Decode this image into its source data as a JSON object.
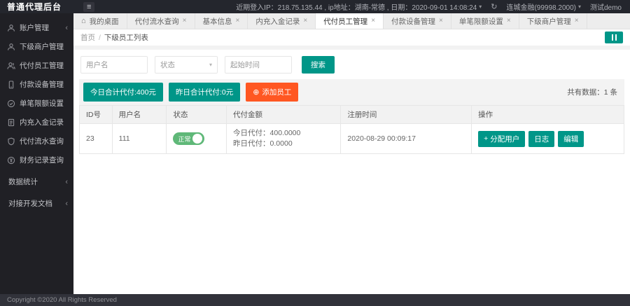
{
  "colors": {
    "teal": "#009688",
    "orange": "#FF5722",
    "green": "#5FB878",
    "header_bg": "#24262D",
    "sidebar_bg": "#202025",
    "footer_bg": "#31323A"
  },
  "icons": {
    "hamburger": "≡",
    "home": "⌂",
    "close": "×",
    "chevron_left": "‹",
    "caret_down": "▾",
    "refresh": "↻",
    "plus": "+"
  },
  "header": {
    "logo": "普通代理后台",
    "login_info": "近期登入IP：218.75.135.44 , ip地址：湖南-常德 , 日期：2020-09-01 14:08:24",
    "merchant": "连城金融(99998.2000)",
    "user": "测试demo"
  },
  "sidebar": {
    "items": [
      {
        "label": "账户管理"
      },
      {
        "label": "下级商户管理"
      },
      {
        "label": "代付员工管理"
      },
      {
        "label": "付款设备管理"
      },
      {
        "label": "单笔限额设置"
      },
      {
        "label": "内充入金记录"
      },
      {
        "label": "代付流水查询"
      },
      {
        "label": "财务记录查询"
      },
      {
        "label": "数据统计"
      },
      {
        "label": "对接开发文档"
      }
    ]
  },
  "tabs": [
    {
      "label": "我的桌面"
    },
    {
      "label": "代付流水查询"
    },
    {
      "label": "基本信息"
    },
    {
      "label": "内充入金记录"
    },
    {
      "label": "代付员工管理"
    },
    {
      "label": "付款设备管理"
    },
    {
      "label": "单笔限额设置"
    },
    {
      "label": "下级商户管理"
    }
  ],
  "breadcrumb": {
    "home": "首页",
    "separator": "/",
    "current": "下级员工列表"
  },
  "filters": {
    "username_placeholder": "用户名",
    "status_placeholder": "状态",
    "time_placeholder": "起始时间",
    "search_label": "搜索"
  },
  "summary": {
    "today_total": "今日合计代付:400元",
    "yesterday_total": "昨日合计代付:0元",
    "add_employee": "添加员工",
    "record_count": "共有数据：1 条"
  },
  "table": {
    "headers": [
      "ID号",
      "用户名",
      "状态",
      "代付金额",
      "注册时间",
      "操作"
    ],
    "rows": [
      {
        "id": "23",
        "username": "111",
        "status": "正常",
        "amount_today": "今日代付：400.0000",
        "amount_yesterday": "昨日代付：0.0000",
        "register_time": "2020-08-29 00:09:17",
        "actions": {
          "assign": "分配用户",
          "log": "日志",
          "edit": "编辑"
        }
      }
    ]
  },
  "footer": {
    "copyright": "Copyright ©2020 All Rights Reserved"
  }
}
